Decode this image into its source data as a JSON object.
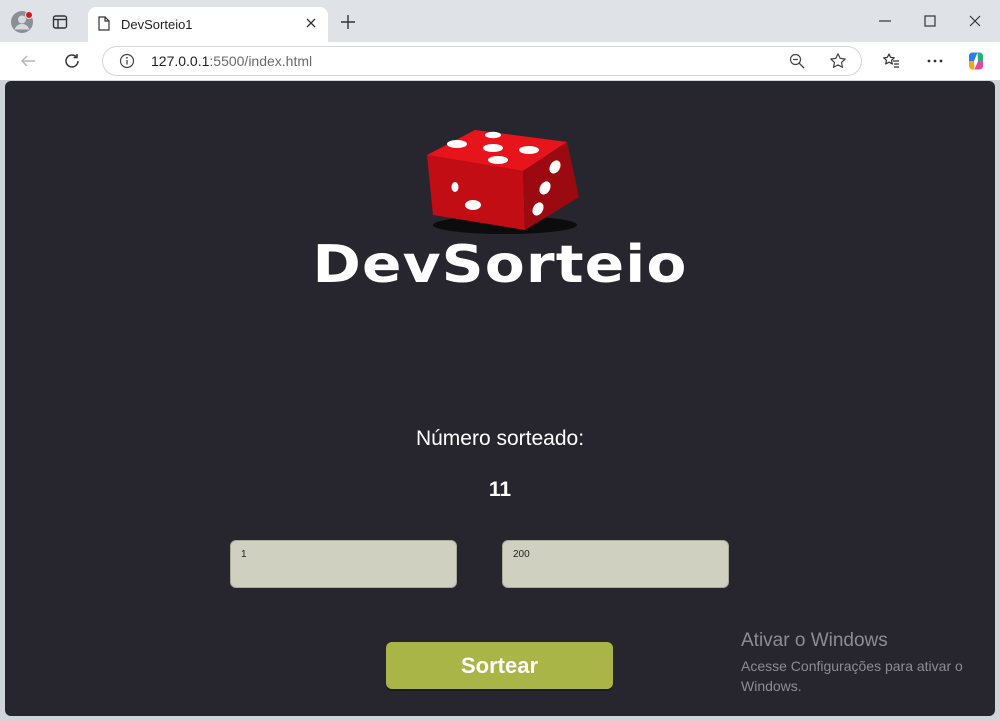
{
  "browser": {
    "tab_title": "DevSorteio1",
    "url_host": "127.0.0.1",
    "url_path": ":5500/index.html"
  },
  "page": {
    "logo_text": "DevSorteio",
    "result_label": "Número sorteado:",
    "result_value": "11",
    "min_input_value": "1",
    "max_input_value": "200",
    "button_label": "Sortear"
  },
  "watermark": {
    "title": "Ativar o Windows",
    "line1": "Acesse Configurações para ativar o",
    "line2": "Windows."
  },
  "colors": {
    "page_bg": "#27262e",
    "button": "#aab547",
    "input_bg": "#cfd0bf",
    "dice": "#e01018"
  }
}
